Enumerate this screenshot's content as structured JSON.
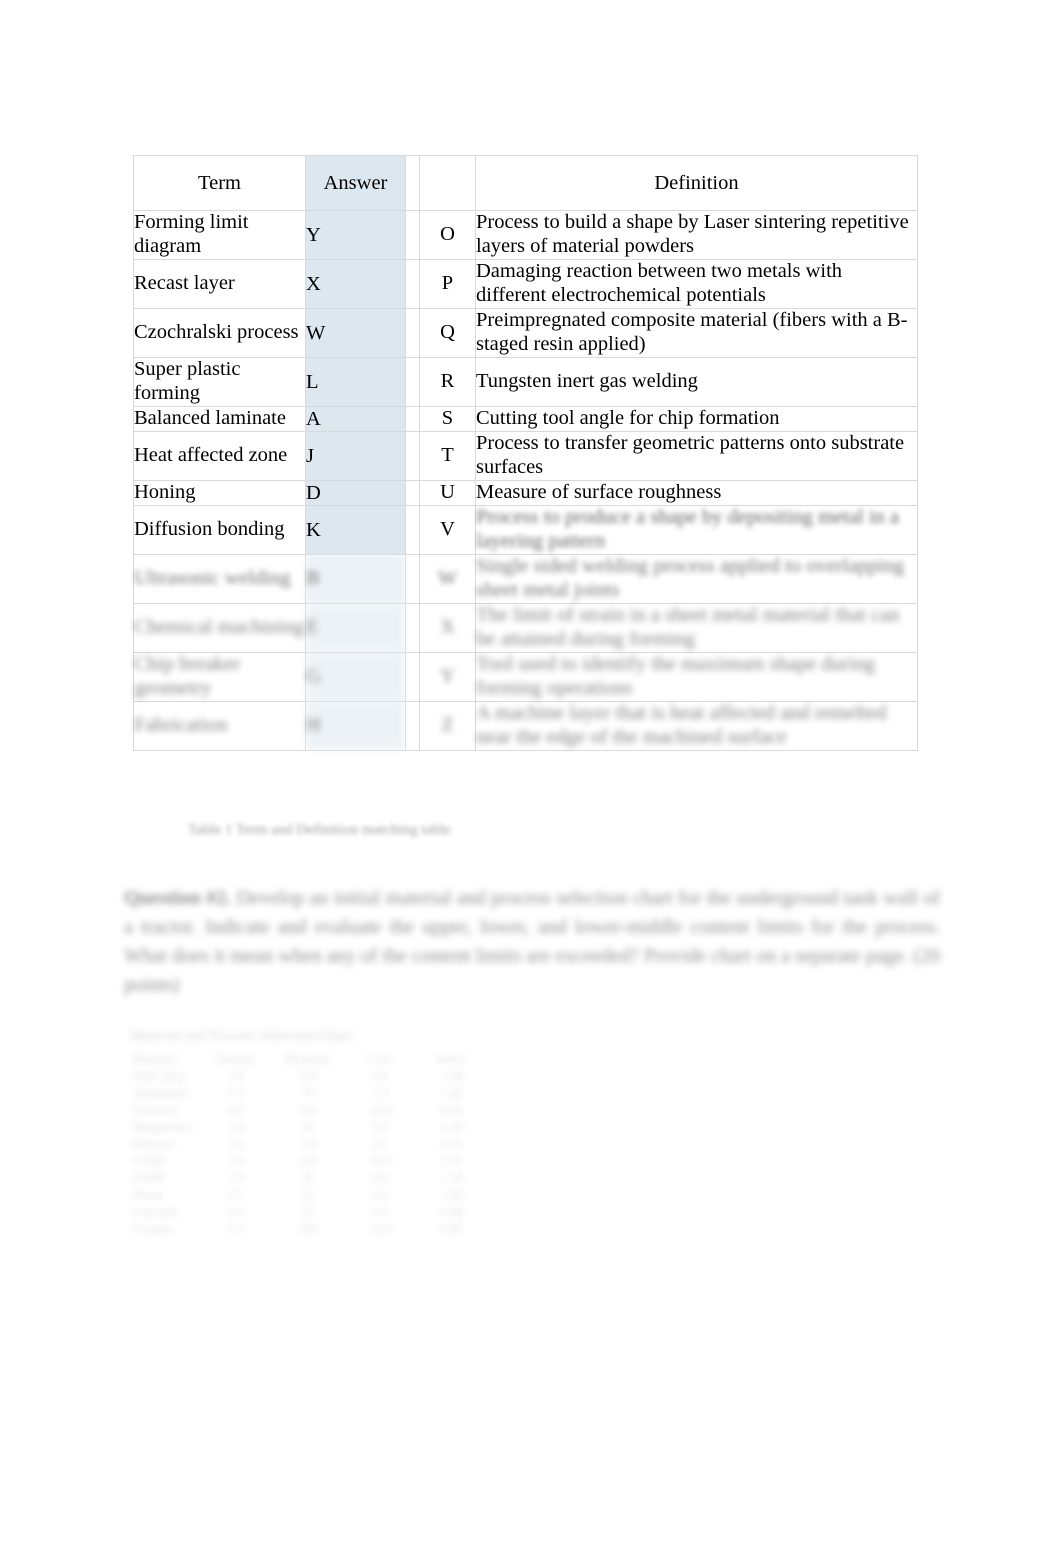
{
  "document": {
    "page_background": "#ffffff",
    "answer_column_fill": "#dce7f0",
    "table_border_color": "#d9d9d9"
  },
  "match_table": {
    "headers": {
      "term": "Term",
      "answer": "Answer",
      "letter": "",
      "definition": "Definition"
    },
    "rows": [
      {
        "term": "Forming limit diagram",
        "answer": "Y",
        "letter": "O",
        "definition": "Process to build a shape by Laser sintering repetitive layers of material powders",
        "blur": "none"
      },
      {
        "term": "Recast layer",
        "answer": "X",
        "letter": "P",
        "definition": "Damaging reaction between two metals with different electrochemical potentials",
        "blur": "none"
      },
      {
        "term": "Czochralski process",
        "answer": "W",
        "letter": "Q",
        "definition": "Preimpregnated composite material (fibers with a B-staged resin applied)",
        "blur": "none"
      },
      {
        "term": "Super plastic forming",
        "answer": "L",
        "letter": "R",
        "definition": "Tungsten inert gas welding",
        "blur": "none"
      },
      {
        "term": "Balanced laminate",
        "answer": "A",
        "letter": "S",
        "definition": "Cutting tool angle for chip formation",
        "blur": "none"
      },
      {
        "term": "Heat affected zone",
        "answer": "J",
        "letter": "T",
        "definition": "Process to transfer geometric patterns onto substrate surfaces",
        "blur": "none"
      },
      {
        "term": "Honing",
        "answer": "D",
        "letter": "U",
        "definition": "Measure of surface roughness",
        "blur": "none"
      },
      {
        "term": "Diffusion bonding",
        "answer": "K",
        "letter": "V",
        "definition": "Process to produce a shape by depositing metal in a layering pattern",
        "blur": "definition"
      },
      {
        "term": "Ultrasonic welding",
        "answer": "B",
        "letter": "W",
        "definition": "Single sided welding process applied to overlapping sheet metal joints",
        "blur": "full"
      },
      {
        "term": "Chemical machining",
        "answer": "E",
        "letter": "X",
        "definition": "The limit of strain in a sheet metal material that can be attained during forming",
        "blur": "full"
      },
      {
        "term": "Chip breaker geometry",
        "answer": "G",
        "letter": "Y",
        "definition": "Tool used to identify the maximum shape during forming operations",
        "blur": "full"
      },
      {
        "term": "Fabrication",
        "answer": "H",
        "letter": "Z",
        "definition": "A machine layer that is heat affected and remelted near the edge of the machined surface",
        "blur": "full"
      }
    ],
    "caption": "Table 1 Term and Definition matching table"
  },
  "question_block": {
    "text_lead": "Question #2.",
    "text": " Develop an initial material and process selection chart for the underground tank wall of a tractor. Indicate and evaluate the upper, lower, and lower-middle content limits for the process. What does it mean when any of the content limits are exceeded? Provide chart on a separate page. (20 points)"
  },
  "bottom_table": {
    "title": "Material and Process Selection Chart",
    "column_headers": [
      "Material",
      "Density",
      "Modulus",
      "Cost",
      "Index"
    ],
    "rows": [
      [
        "Steel alloy",
        "7.8",
        "210",
        "0.8",
        "1.00"
      ],
      [
        "Aluminum",
        "2.7",
        "70",
        "1.9",
        "1.42"
      ],
      [
        "Titanium",
        "4.5",
        "110",
        "18.0",
        "0.65"
      ],
      [
        "Magnesium",
        "1.8",
        "45",
        "3.2",
        "1.28"
      ],
      [
        "Polymer",
        "1.2",
        "3.5",
        "2.1",
        "0.55"
      ],
      [
        "CFRP",
        "1.6",
        "120",
        "30.0",
        "2.35"
      ],
      [
        "GFRP",
        "1.9",
        "35",
        "6.0",
        "1.10"
      ],
      [
        "Wood",
        "0.7",
        "12",
        "0.5",
        "1.60"
      ],
      [
        "Concrete",
        "2.4",
        "25",
        "0.1",
        "0.40"
      ],
      [
        "Ceramic",
        "3.1",
        "320",
        "12.0",
        "0.85"
      ]
    ]
  }
}
